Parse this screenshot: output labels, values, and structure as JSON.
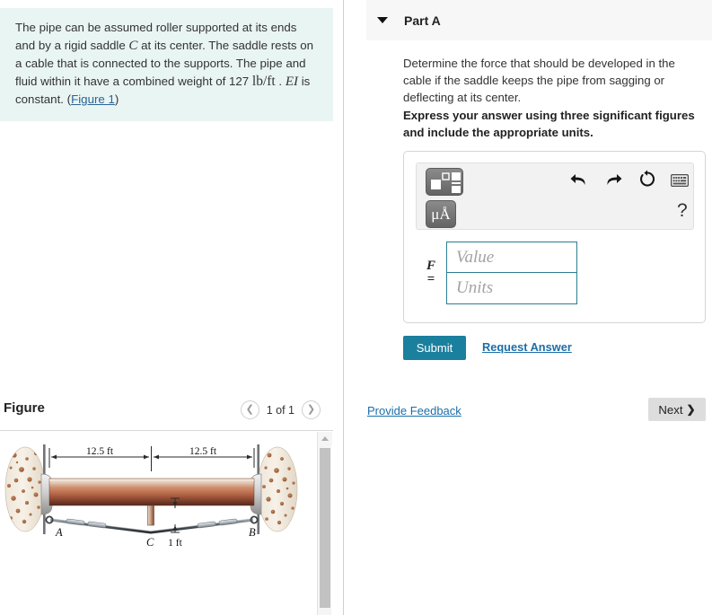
{
  "problem": {
    "text_part1": "The pipe can be assumed roller supported at its ends and by a rigid saddle ",
    "var_c": "C",
    "text_part2": " at its center. The saddle rests on a cable that is connected to the supports. The pipe and fluid within it have a combined weight of 127 ",
    "unit_weight": "lb/ft",
    "text_part3": " . ",
    "var_ei": "EI",
    "text_part4": " is constant. (",
    "figure_link": "Figure 1",
    "text_part5": ")"
  },
  "figure_panel": {
    "title": "Figure",
    "pager_label": "1 of 1",
    "prev_icon": "chevron-left-icon",
    "next_icon": "chevron-right-icon"
  },
  "figure_diagram": {
    "dim_left": "12.5 ft",
    "dim_right": "12.5 ft",
    "dim_sag": "1 ft",
    "label_a": "A",
    "label_b": "B",
    "label_c": "C",
    "pipe_color_top": "#e8d4c6",
    "pipe_color_mid": "#c07a5c",
    "pipe_color_bottom": "#5a3022",
    "wall_color": "#f3ece2",
    "aggregate_color": "#a9683f",
    "cable_color": "#4a4f55"
  },
  "part": {
    "title": "Part A",
    "caret_icon": "triangle-down-icon",
    "question": "Determine the force that should be developed in the cable if the saddle keeps the pipe from sagging or deflecting at its center.",
    "express": "Express your answer using three significant figures and include the appropriate units."
  },
  "answer": {
    "toolbar": {
      "template_icon": "math-template-icon",
      "units_label": "μÅ",
      "units_icon": "units-template-icon",
      "undo_icon": "undo-arrow-icon",
      "undo_glyph": "↶",
      "redo_icon": "redo-arrow-icon",
      "redo_glyph": "↷",
      "reset_icon": "reset-circular-arrow-icon",
      "reset_glyph": "⟳",
      "keyboard_icon": "keyboard-icon",
      "help_icon": "help-question-icon",
      "help_glyph": "?"
    },
    "variable_label": "F",
    "equals_label": "=",
    "value_placeholder": "Value",
    "units_placeholder": "Units",
    "value_current": "",
    "units_current": "",
    "submit_label": "Submit",
    "request_answer_label": "Request Answer"
  },
  "footer": {
    "feedback_label": "Provide Feedback",
    "next_label": "Next",
    "next_chevron": "❯"
  },
  "colors": {
    "problem_bg": "#e9f5f3",
    "submit_teal": "#1b7f9e",
    "link_blue": "#1b6ea8",
    "field_border": "#2a7f93",
    "part_header_bg": "#f7f7f7"
  }
}
